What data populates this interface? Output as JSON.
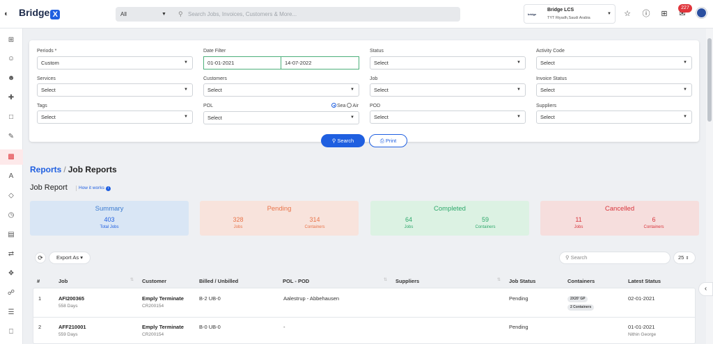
{
  "header": {
    "logo_text": "Bridge",
    "logo_mark": "X",
    "search_scope": "All",
    "search_placeholder": "Search Jobs, Invoices, Customers & More...",
    "company_name": "Bridge LCS",
    "company_location": "TYT Riyadh,Saudi Arabia",
    "company_logo_text": "bridge",
    "notification_count": "227",
    "icons": [
      "menu-toggle-icon",
      "star-icon",
      "help-icon",
      "apps-grid-icon",
      "notification-icon",
      "avatar"
    ]
  },
  "sidebar": {
    "items": [
      "dashboard-icon",
      "user-icon",
      "users-icon",
      "add-user-icon",
      "bookmark-icon",
      "edit-icon",
      "reports-icon",
      "font-icon",
      "tag-icon",
      "clock-icon",
      "card-icon",
      "transfer-icon",
      "box-icon",
      "cart-icon",
      "layers-icon",
      "inbox-icon"
    ],
    "active_index": 6
  },
  "filters": {
    "periods": {
      "label": "Periods *",
      "value": "Custom"
    },
    "date_filter": {
      "label": "Date Filter",
      "from": "01-01-2021",
      "to": "14-07-2022"
    },
    "status": {
      "label": "Status",
      "value": "Select"
    },
    "activity_code": {
      "label": "Activity Code",
      "value": "Select"
    },
    "services": {
      "label": "Services",
      "value": "Select"
    },
    "customers": {
      "label": "Customers",
      "value": "Select"
    },
    "job": {
      "label": "Job",
      "value": "Select"
    },
    "invoice_status": {
      "label": "Invoice Status",
      "value": "Select"
    },
    "tags": {
      "label": "Tags",
      "value": "Select"
    },
    "pol": {
      "label": "POL",
      "value": "Select",
      "mode_sea": "Sea",
      "mode_air": "Air"
    },
    "pod": {
      "label": "POD",
      "value": "Select"
    },
    "suppliers": {
      "label": "Suppliers",
      "value": "Select"
    },
    "search_label": "Search",
    "print_label": "Print"
  },
  "breadcrumb": {
    "parent": "Reports",
    "separator": "/",
    "current": "Job Reports"
  },
  "report": {
    "title": "Job Report",
    "how_it_works": "How it works",
    "info_glyph": "i"
  },
  "summary_cards": {
    "summary": {
      "title": "Summary",
      "value": "403",
      "label": "Total Jobs",
      "color": "#1f5fe0"
    },
    "pending": {
      "title": "Pending",
      "jobs": "328",
      "jobs_label": "Jobs",
      "containers": "314",
      "containers_label": "Containers",
      "color": "#e8744a"
    },
    "completed": {
      "title": "Completed",
      "jobs": "64",
      "jobs_label": "Jobs",
      "containers": "59",
      "containers_label": "Containers",
      "color": "#2ea86b"
    },
    "cancelled": {
      "title": "Cancelled",
      "jobs": "11",
      "jobs_label": "Jobs",
      "containers": "6",
      "containers_label": "Containers",
      "color": "#d8343b"
    }
  },
  "toolbar": {
    "export_label": "Export As",
    "search_placeholder": "Search",
    "page_size": "25"
  },
  "table": {
    "columns": [
      "#",
      "Job",
      "Customer",
      "Billed / Unbilled",
      "POL - POD",
      "Suppliers",
      "Job Status",
      "Containers",
      "Latest Status"
    ],
    "rows": [
      {
        "index": "1",
        "job": "AFI200365",
        "days": "558 Days",
        "customer": "Emply Terminate",
        "customer_code": "CR200154",
        "billed": "B-2 UB-0",
        "pol_pod": "Aalestrup - Abbehausen",
        "suppliers": "",
        "status": "Pending",
        "container_type": "2X20' GP",
        "container_count": "2 Containers",
        "latest_status": "02-01-2021",
        "latest_by": ""
      },
      {
        "index": "2",
        "job": "AFF210001",
        "days": "559 Days",
        "customer": "Emply Terminate",
        "customer_code": "CR200154",
        "billed": "B-0 UB-0",
        "pol_pod": "-",
        "suppliers": "",
        "status": "Pending",
        "container_type": "",
        "container_count": "",
        "latest_status": "01-01-2021",
        "latest_by": "Nithin George"
      }
    ]
  }
}
